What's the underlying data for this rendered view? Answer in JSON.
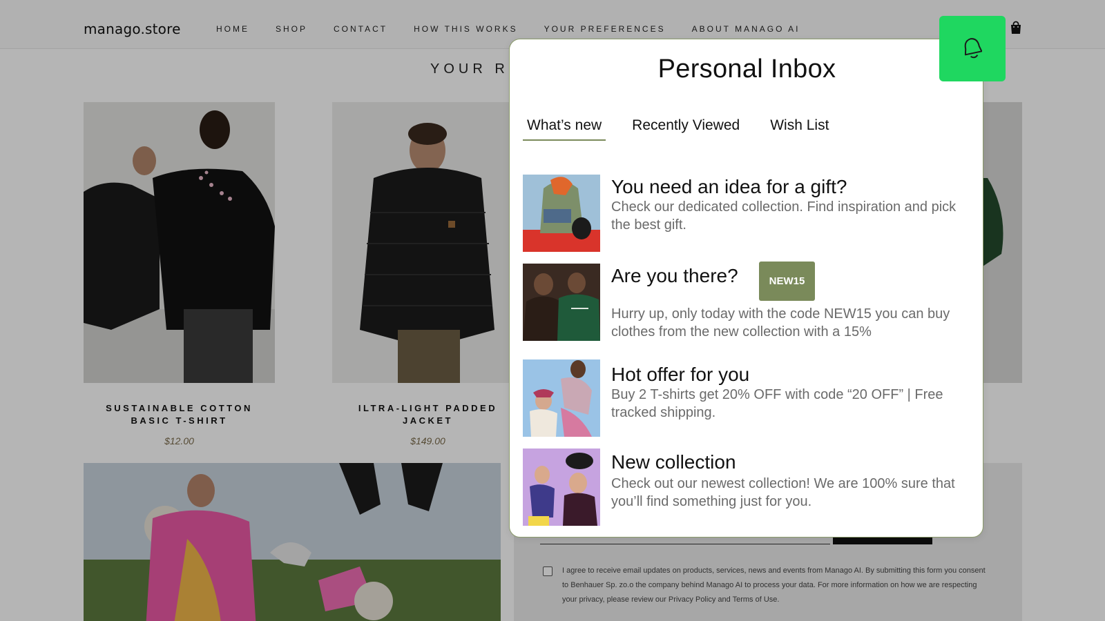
{
  "header": {
    "logo": "manago.store",
    "nav": [
      "HOME",
      "SHOP",
      "CONTACT",
      "HOW THIS WORKS",
      "YOUR PREFERENCES",
      "ABOUT MANAGO AI"
    ]
  },
  "section": {
    "title": "YOUR RE"
  },
  "products": [
    {
      "name": "SUSTAINABLE COTTON BASIC T-SHIRT",
      "price": "$12.00"
    },
    {
      "name": "ILTRA-LIGHT PADDED JACKET",
      "price": "$149.00"
    }
  ],
  "newsletter": {
    "consent": "I agree to receive email updates on products, services, news and events from Manago AI. By submitting this form you consent to Benhauer Sp. zo.o the company behind Manago AI to process your data. For more information on how we are respecting your privacy, please review our Privacy Policy and Terms of Use."
  },
  "inbox": {
    "title": "Personal Inbox",
    "tabs": [
      "What’s new",
      "Recently Viewed",
      "Wish List"
    ],
    "active_tab": "What’s new",
    "accent_color": "#7a8a5a",
    "bell_color": "#1fd760",
    "messages": [
      {
        "title": "You need an idea for a gift?",
        "body": "Check our dedicated collection. Find inspiration and pick the best gift."
      },
      {
        "title": "Are you there?",
        "badge": "NEW15",
        "body": "Hurry up, only today with the code NEW15 you can buy clothes from the new collection with a 15%"
      },
      {
        "title": "Hot offer for you",
        "body": "Buy 2 T-shirts get 20% OFF with code “20 OFF” | Free tracked shipping."
      },
      {
        "title": "New collection",
        "body": "Check out our newest collection! We are 100% sure that you’ll find something just for you."
      }
    ]
  }
}
